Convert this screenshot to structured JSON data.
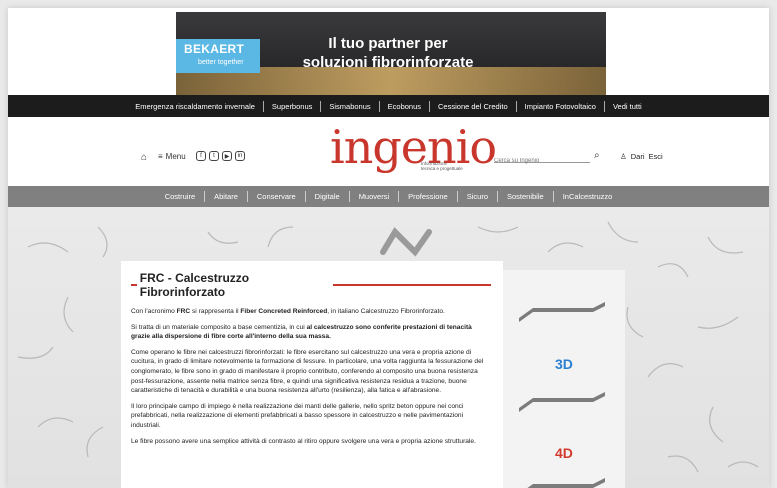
{
  "ad": {
    "brand": "BEKAERT",
    "tagline": "better together",
    "headline_line1": "Il tuo partner per",
    "headline_line2": "soluzioni fibrorinforzate"
  },
  "topnav": {
    "items": [
      "Emergenza riscaldamento invernale",
      "Superbonus",
      "Sismabonus",
      "Ecobonus",
      "Cessione del Credito",
      "Impianto Fotovoltaico",
      "Vedi tutti"
    ]
  },
  "header": {
    "menu_label": "Menu",
    "brand": "ingenio",
    "brand_sub_line1": "Informazione",
    "brand_sub_line2": "tecnica e progettuale",
    "search_placeholder": "Cerca su Ingenio",
    "user_label1": "Dari",
    "user_label2": "Esci"
  },
  "catnav": {
    "items": [
      "Costruire",
      "Abitare",
      "Conservare",
      "Digitale",
      "Muoversi",
      "Professione",
      "Sicuro",
      "Sostenibile",
      "InCalcestruzzo"
    ]
  },
  "article": {
    "title": "FRC - Calcestruzzo Fibrorinforzato",
    "p1_a": "Con l'acronimo ",
    "p1_b": "FRC",
    "p1_c": " si rappresenta il ",
    "p1_d": "Fiber Concreted Reinforced",
    "p1_e": ", in italiano Calcestruzzo Fibrorinforzato.",
    "p2_a": "Si tratta di un materiale composito a base cementizia, in cui ",
    "p2_b": "al calcestruzzo sono conferite prestazioni di tenacità grazie alla dispersione di fibre corte all'interno della sua massa.",
    "p3": "Come operano le fibre nei calcestruzzi fibrorinforzati: le fibre esercitano sul calcestruzzo una vera e propria azione di cucitura, in grado di limitare notevolmente la formazione di fessure. In particolare, una volta raggiunta la fessurazione del conglomerato, le fibre sono in grado di manifestare il proprio contributo, conferendo al composito una buona resistenza post-fessurazione, assente nella matrice senza fibre, e quindi una significativa resistenza residua a trazione, buone caratteristiche di tenacità e durabilità e una buona resistenza all'urto (resilienza), alla fatica e all'abrasione.",
    "p4": "Il loro principale campo di impiego è nella realizzazione dei manti delle gallerie, nello spritz beton oppure nei conci prefabbricati, nella realizzazione di elementi prefabbricati a basso spessore in calcestruzzo e nelle pavimentazioni industriali.",
    "p5": "Le fibre possono avere una semplice attività di contrasto al ritiro oppure svolgere una vera e propria azione strutturale."
  },
  "side": {
    "label_3d": "3D",
    "label_4d": "4D"
  },
  "colors": {
    "brand_red": "#c8362c",
    "topnav_bg": "#1c1c1c",
    "catnav_bg": "#808080",
    "label_3d": "#2a7fd0",
    "label_4d": "#d23a2e"
  }
}
